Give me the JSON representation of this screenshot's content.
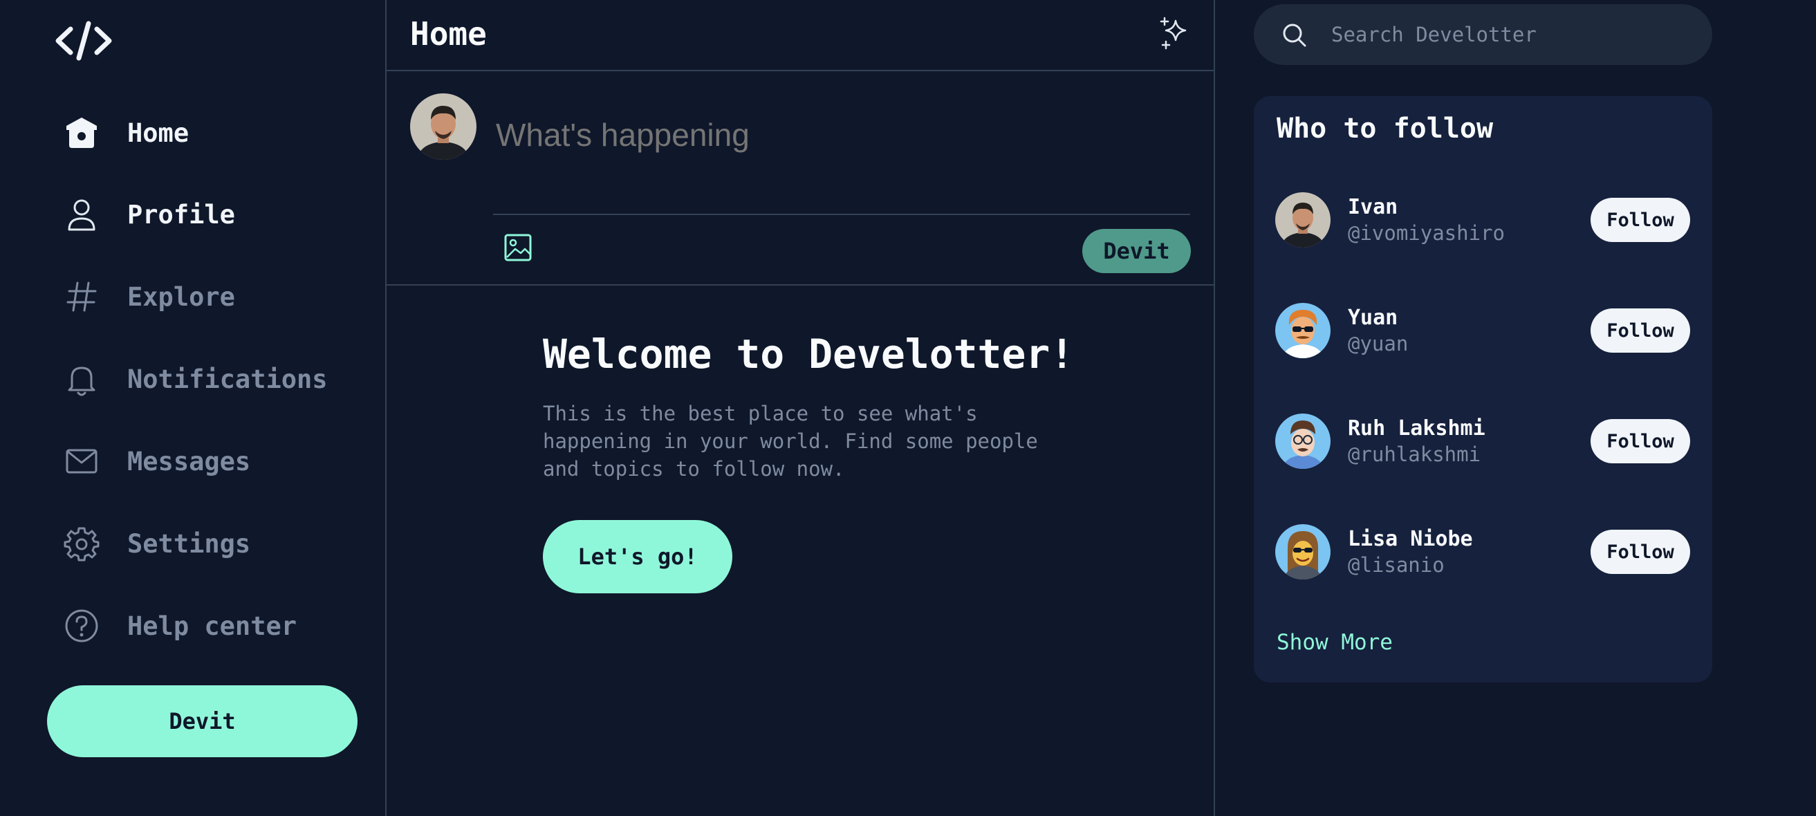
{
  "app": {
    "logo": "code-logo",
    "accent": "#8ff7d9",
    "background": "#0f172a"
  },
  "sidebar": {
    "items": [
      {
        "label": "Home",
        "icon": "home-icon",
        "active": true
      },
      {
        "label": "Profile",
        "icon": "user-icon",
        "active": false
      },
      {
        "label": "Explore",
        "icon": "hashtag-icon",
        "active": false
      },
      {
        "label": "Notifications",
        "icon": "bell-icon",
        "active": false
      },
      {
        "label": "Messages",
        "icon": "mail-icon",
        "active": false
      },
      {
        "label": "Settings",
        "icon": "gear-icon",
        "active": false
      },
      {
        "label": "Help center",
        "icon": "help-icon",
        "active": false
      }
    ],
    "devit_label": "Devit"
  },
  "header": {
    "title": "Home",
    "action_icon": "sparkle-icon"
  },
  "composer": {
    "placeholder": "What's happening",
    "submit_label": "Devit",
    "media_icon": "image-icon"
  },
  "welcome": {
    "title": "Welcome to Develotter!",
    "text": "This is the best place to see what's happening in your world. Find some people and topics to follow now.",
    "cta_label": "Let's go!"
  },
  "search": {
    "placeholder": "Search Develotter"
  },
  "who_to_follow": {
    "title": "Who to follow",
    "users": [
      {
        "name": "Ivan",
        "handle": "@ivomiyashiro",
        "button": "Follow"
      },
      {
        "name": "Yuan",
        "handle": "@yuan",
        "button": "Follow"
      },
      {
        "name": "Ruh Lakshmi",
        "handle": "@ruhlakshmi",
        "button": "Follow"
      },
      {
        "name": "Lisa Niobe",
        "handle": "@lisanio",
        "button": "Follow"
      }
    ],
    "show_more": "Show More"
  }
}
